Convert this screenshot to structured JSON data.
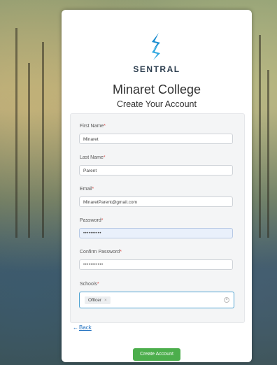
{
  "brand": {
    "name": "SENTRAL",
    "icon": "sentral-logo-icon"
  },
  "header": {
    "school": "Minaret College",
    "subtitle": "Create Your Account"
  },
  "form": {
    "first_name": {
      "label": "First Name",
      "required": "*",
      "value": "Minaret"
    },
    "last_name": {
      "label": "Last Name",
      "required": "*",
      "value": "Parent"
    },
    "email": {
      "label": "Email",
      "required": "*",
      "value": "MinaretParent@gmail.com"
    },
    "password": {
      "label": "Password",
      "required": "*",
      "value": "••••••••••"
    },
    "confirm_password": {
      "label": "Confirm Password",
      "required": "*",
      "value": "•••••••••••"
    },
    "schools": {
      "label": "Schools",
      "required": "*",
      "selected": "Officer",
      "remove": "×"
    }
  },
  "nav": {
    "back_label": "Back",
    "back_icon": "←"
  },
  "actions": {
    "create_label": "Create Account"
  },
  "colors": {
    "accent": "#4fa3d1",
    "button": "#4cae4c",
    "brand": "#2d3e4f",
    "link": "#1e6fbf"
  }
}
